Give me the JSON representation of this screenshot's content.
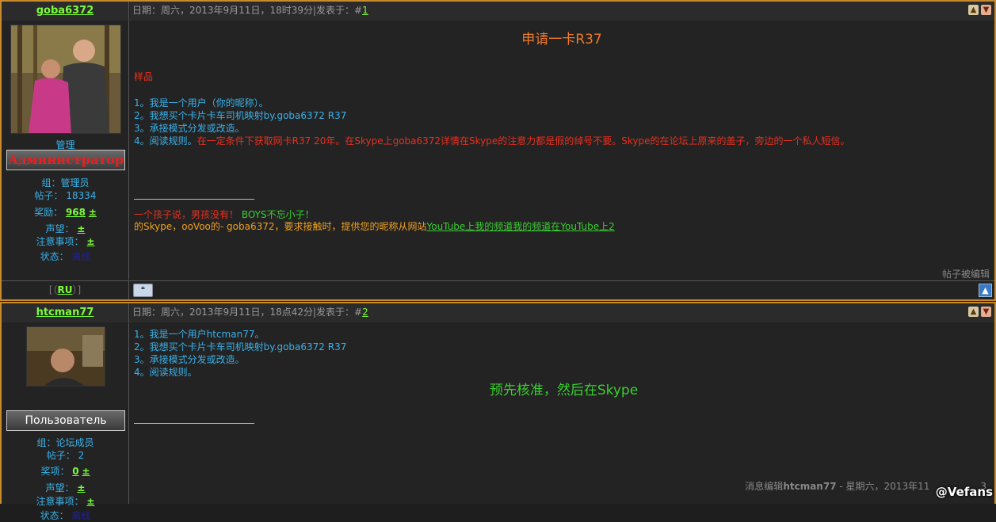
{
  "posts": [
    {
      "author": "goba6372",
      "date_text": "日期：周六，2013年9月11日，18时39分|发表于：#",
      "post_number": "1",
      "rank_label": "管理",
      "role": "Администратор",
      "group_line": "组：管理员",
      "posts_label": "帖子：",
      "posts_count": "18334",
      "reward_label": "奖励：",
      "reward_value": "968",
      "plus": "±",
      "reputation_label": "声望：",
      "notes_label": "注意事项：",
      "status_label": "状态：",
      "status_value": "离线",
      "lang_prefix": "[（",
      "lang": "RU",
      "lang_suffix": "）]",
      "title": "申请一卡R37",
      "sample_label": "样品",
      "items": [
        "1。我是一个用户（你的昵称）。",
        "2。我想买个卡片卡车司机映射by.goba6372 R37",
        "3。承接模式分发或改造。"
      ],
      "item4_prefix": "4。阅读规则。",
      "item4_red": "在一定条件下获取网卡R37 20年。在Skype上goba6372详情在Skype的注意力都是假的绰号不要。Skype的在论坛上原来的盖子，旁边的一个私人短信。",
      "sig_red": "一个孩子说，男孩没有！",
      "sig_green": "BOYS不忘小子！",
      "sig_orange": "的Skype，ooVoo的- goba6372，要求接触时，提供您的昵称从网站",
      "sig_link": "YouTube上我的频道我的频道在YouTube上2",
      "edited_note": "帖子被编辑"
    },
    {
      "author": "htcman77",
      "date_text": "日期：周六，2013年9月11日，18点42分|发表于：#",
      "post_number": "2",
      "role": "Пользователь",
      "group_line": "组：论坛成员",
      "posts_label": "帖子：",
      "posts_count": "2",
      "reward_label": "奖项：",
      "reward_value": "0",
      "plus": "±",
      "reputation_label": "声望：",
      "notes_label": "注意事项：",
      "status_label": "状态：",
      "status_value": "离线",
      "items": [
        "1。我是一个用户htcman77。",
        "2。我想买个卡片卡车司机映射by.goba6372 R37",
        "3。承接模式分发或改造。",
        "4。阅读规则。"
      ],
      "reply": "预先核准，然后在Skype",
      "edit_prefix": "消息编辑",
      "edit_user": "htcman77",
      "edit_suffix": "- 星期六，2013年11",
      "edit_tail": "3"
    }
  ],
  "watermark": "@Vefans",
  "colors": {
    "frame": "#c88a2c",
    "link_green": "#7cfc3a",
    "text_blue": "#3ab0e8",
    "text_red": "#e83020",
    "text_green": "#3ad030",
    "text_orange": "#f0a020"
  },
  "icons": [
    "thumbs-up-icon",
    "thumbs-down-icon",
    "avatar-image",
    "quote-icon",
    "scroll-top-icon"
  ]
}
